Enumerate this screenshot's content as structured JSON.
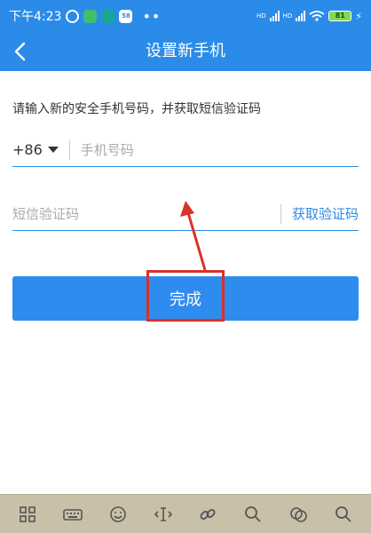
{
  "status_bar": {
    "time": "下午4:23",
    "signal1_label": "HD",
    "signal2_label": "HD",
    "battery": "81"
  },
  "nav": {
    "title": "设置新手机"
  },
  "form": {
    "instruction": "请输入新的安全手机号码，并获取短信验证码",
    "country_code": "+86",
    "phone_placeholder": "手机号码",
    "code_placeholder": "短信验证码",
    "get_code_label": "获取验证码",
    "submit_label": "完成"
  },
  "keyboard_toolbar": {
    "icons": [
      "grid-icon",
      "keyboard-icon",
      "emoji-icon",
      "cursor-icon",
      "link-icon",
      "search-icon",
      "sticker-icon",
      "search-icon"
    ]
  },
  "colors": {
    "primary": "#2b8be8",
    "highlight": "#d9312b",
    "toolbar": "#c8c0a8"
  }
}
